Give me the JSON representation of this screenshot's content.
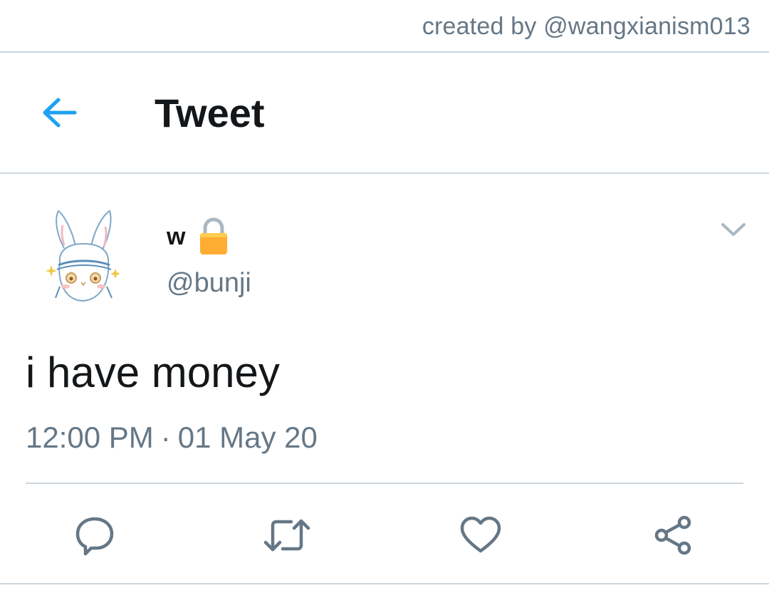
{
  "watermark": {
    "credit": "created by @wangxianism013"
  },
  "header": {
    "title": "Tweet",
    "back_icon": "arrow-left-icon"
  },
  "tweet": {
    "author": {
      "display_name": "w",
      "handle": "@bunji",
      "lock_icon": "lock-icon",
      "avatar_icon": "bunny-avatar"
    },
    "text": "i have money",
    "time": "12:00 PM",
    "separator": "·",
    "date": "01 May 20"
  },
  "actions": [
    {
      "icon": "reply-icon"
    },
    {
      "icon": "retweet-icon"
    },
    {
      "icon": "heart-icon"
    },
    {
      "icon": "share-icon"
    }
  ],
  "colors": {
    "accent": "#1da1f2",
    "secondary_text": "#657786",
    "divider": "#ccd6dd",
    "lock": "#ffac33"
  }
}
